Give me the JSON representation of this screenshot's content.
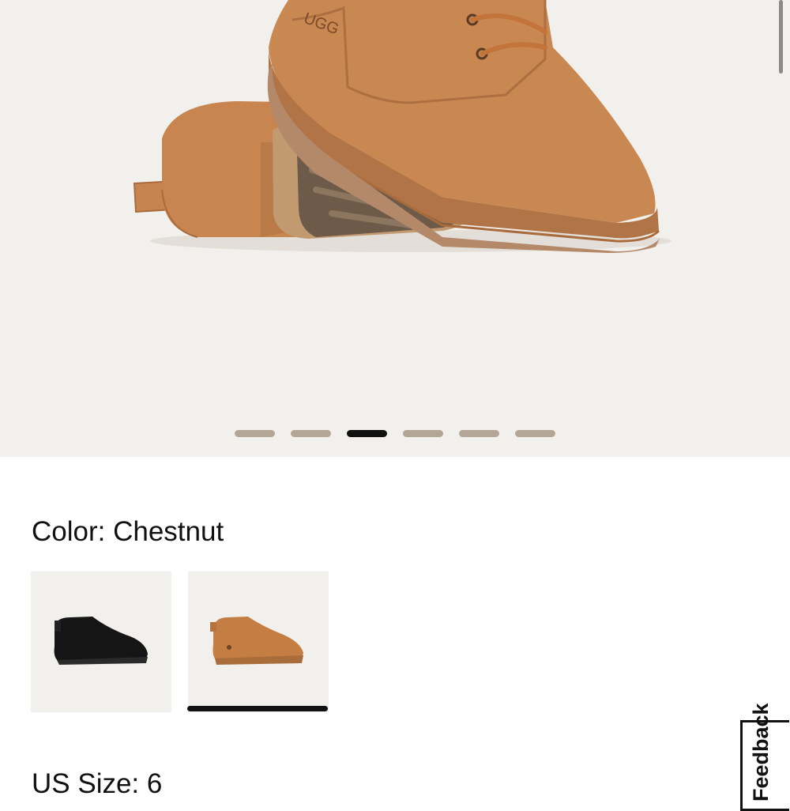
{
  "product_gallery": {
    "image_count": 6,
    "active_index": 2,
    "image_description": "Chestnut suede boot pair"
  },
  "color_selector": {
    "label": "Color: Chestnut",
    "options": [
      {
        "name": "Black",
        "selected": false
      },
      {
        "name": "Chestnut",
        "selected": true
      }
    ]
  },
  "size_selector": {
    "label": "US Size: 6"
  },
  "feedback_tab": {
    "label": "Feedback"
  },
  "colors": {
    "hero_background": "#f2f0ed",
    "active_dot": "#111111",
    "inactive_dot": "#b4a696",
    "chestnut": "#c7864f",
    "sole": "#b38a62"
  }
}
